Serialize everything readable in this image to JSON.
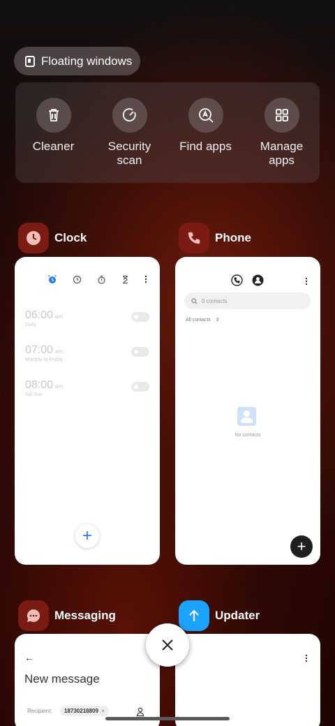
{
  "floating_windows": {
    "label": "Floating windows"
  },
  "tools": [
    {
      "label": "Cleaner",
      "icon": "trash-icon"
    },
    {
      "label": "Security\nscan",
      "icon": "security-scan-icon"
    },
    {
      "label": "Find apps",
      "icon": "find-apps-icon"
    },
    {
      "label": "Manage\napps",
      "icon": "grid-icon"
    }
  ],
  "apps": {
    "clock": {
      "name": "Clock",
      "icon_color": "#7a1c14",
      "alarms": [
        {
          "time": "06:00",
          "ampm": "am",
          "sub": "Daily"
        },
        {
          "time": "07:00",
          "ampm": "am",
          "sub": "Monday to Friday"
        },
        {
          "time": "08:00",
          "ampm": "am",
          "sub": "Sat Sun"
        }
      ],
      "accent": "#2a7bef"
    },
    "phone": {
      "name": "Phone",
      "icon_color": "#7a1c14",
      "search_placeholder": "0 contacts",
      "filter": "All contacts",
      "empty": "No contacts"
    },
    "messaging": {
      "name": "Messaging",
      "icon_color": "#7a1c14",
      "title": "New message",
      "recipient_label": "Recipient:",
      "recipient_chip": "18730218809"
    },
    "updater": {
      "name": "Updater",
      "icon_color": "#1aa3ff"
    }
  }
}
